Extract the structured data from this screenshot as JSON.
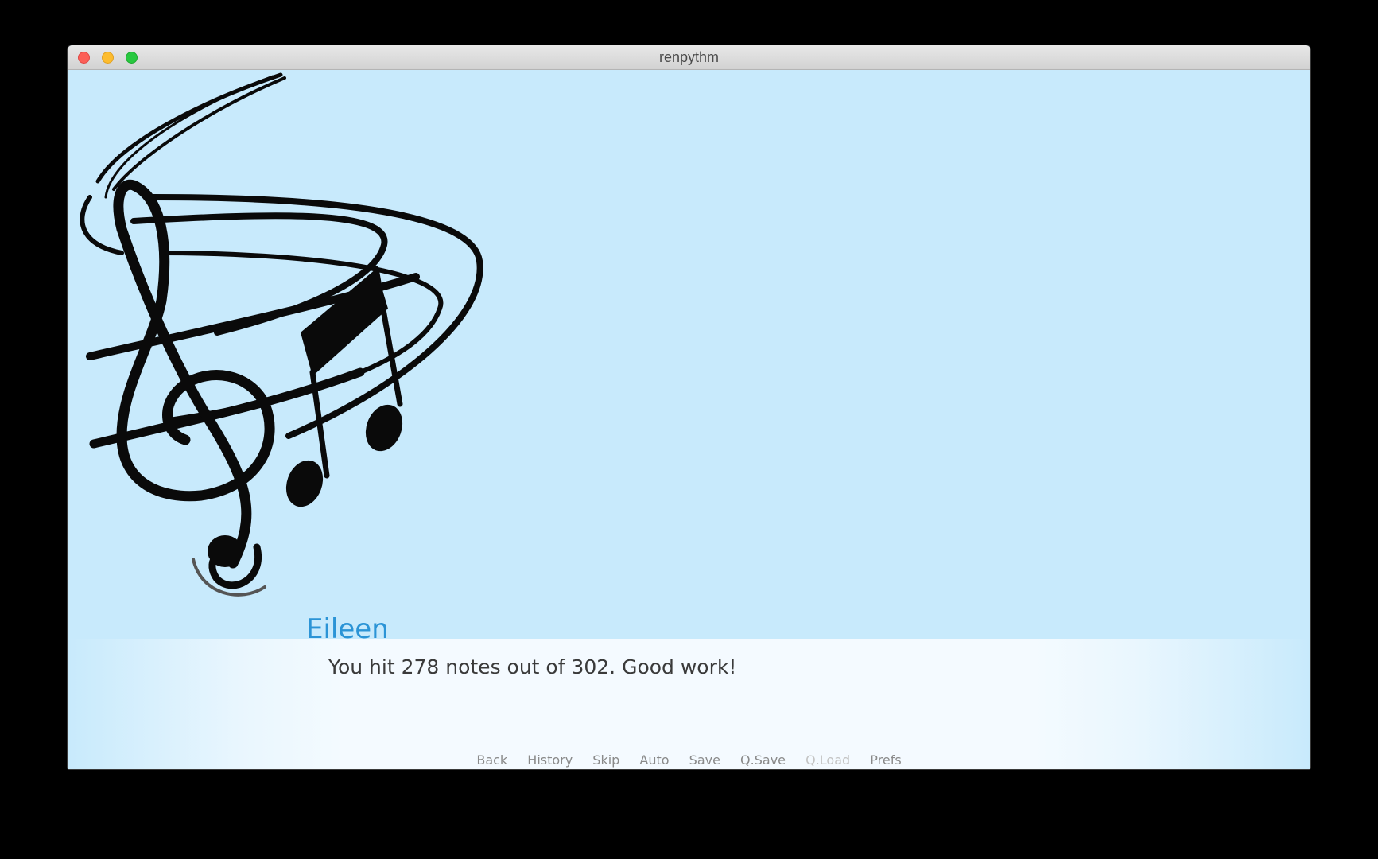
{
  "window": {
    "title": "renpythm"
  },
  "dialogue": {
    "speaker": "Eileen",
    "text": "You hit 278 notes out of 302. Good work!"
  },
  "quick_menu": [
    {
      "label": "Back",
      "enabled": true
    },
    {
      "label": "History",
      "enabled": true
    },
    {
      "label": "Skip",
      "enabled": true
    },
    {
      "label": "Auto",
      "enabled": true
    },
    {
      "label": "Save",
      "enabled": true
    },
    {
      "label": "Q.Save",
      "enabled": true
    },
    {
      "label": "Q.Load",
      "enabled": false
    },
    {
      "label": "Prefs",
      "enabled": true
    }
  ],
  "colors": {
    "background": "#c8eafc",
    "speaker_name": "#2b94d6",
    "dialogue_text": "#3a3a3a",
    "menu_text": "#8a8a8a",
    "menu_text_disabled": "#c4c4c4"
  },
  "icons": {
    "background_art": "treble-clef-with-music-notes"
  }
}
